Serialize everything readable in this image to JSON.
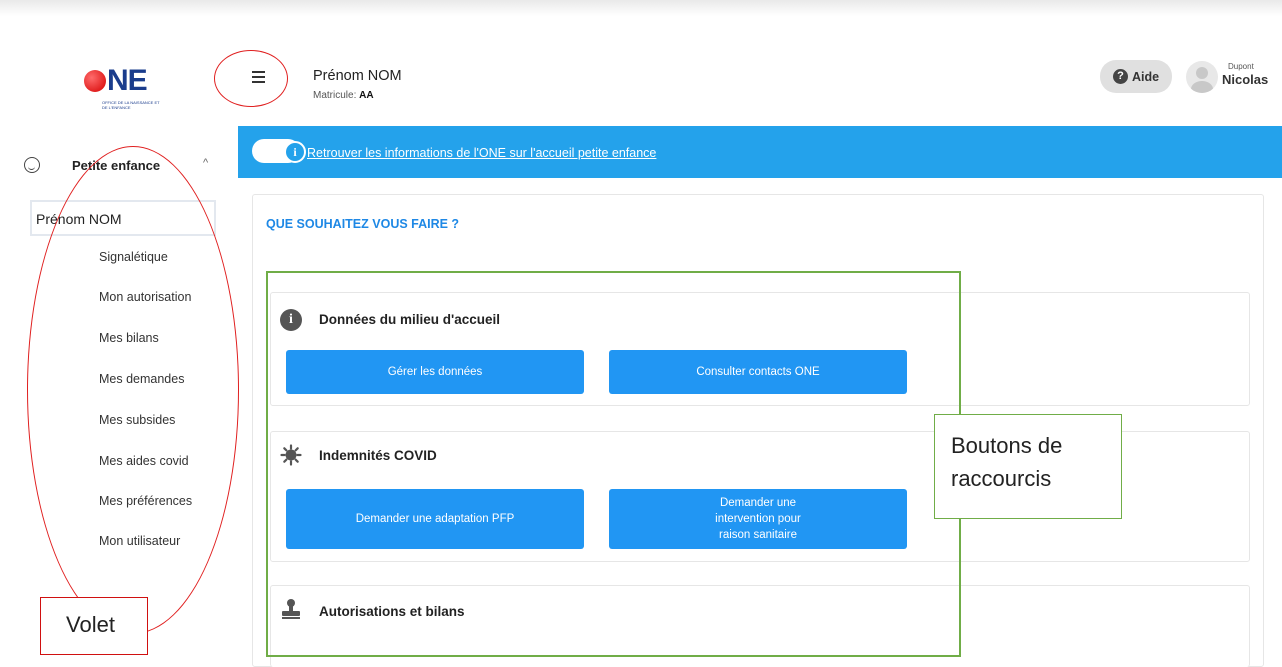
{
  "logo": {
    "word": "NE",
    "subtitle": "OFFICE DE LA NAISSANCE ET DE L'ENFANCE"
  },
  "header": {
    "menu_icon": "hamburger-icon",
    "user_name": "Prénom NOM",
    "matricule_label": "Matricule:",
    "matricule_value": "AA",
    "help_label": "Aide",
    "account_first": "Dupont",
    "account_last": "Nicolas"
  },
  "sidebar": {
    "group_label": "Petite enfance",
    "group_icon": "baby-face-icon",
    "person": "Prénom NOM",
    "items": [
      {
        "label": "Signalétique"
      },
      {
        "label": "Mon autorisation"
      },
      {
        "label": "Mes bilans"
      },
      {
        "label": "Mes demandes"
      },
      {
        "label": "Mes subsides"
      },
      {
        "label": "Mes aides covid"
      },
      {
        "label": "Mes préférences"
      },
      {
        "label": "Mon utilisateur"
      }
    ]
  },
  "banner": {
    "text": "Retrouver les informations de l'ONE sur l'accueil petite enfance",
    "color": "#24a2eb"
  },
  "main": {
    "heading": "QUE SOUHAITEZ VOUS FAIRE ?",
    "panels": [
      {
        "title": "Données du milieu d'accueil",
        "icon": "info-icon",
        "buttons": [
          {
            "label": "Gérer les données"
          },
          {
            "label": "Consulter contacts ONE"
          }
        ]
      },
      {
        "title": "Indemnités COVID",
        "icon": "virus-icon",
        "buttons": [
          {
            "label": "Demander une adaptation PFP"
          },
          {
            "label": "Demander une intervention pour raison sanitaire"
          }
        ]
      },
      {
        "title": "Autorisations et bilans",
        "icon": "stamp-icon",
        "buttons": []
      }
    ]
  },
  "annotations": {
    "shortcuts": "Boutons de raccourcis",
    "panel": "Volet"
  },
  "colors": {
    "primary_button": "#2196f3",
    "heading": "#1e88e5",
    "annotation_red": "#e02020",
    "annotation_green": "#70ad47"
  }
}
